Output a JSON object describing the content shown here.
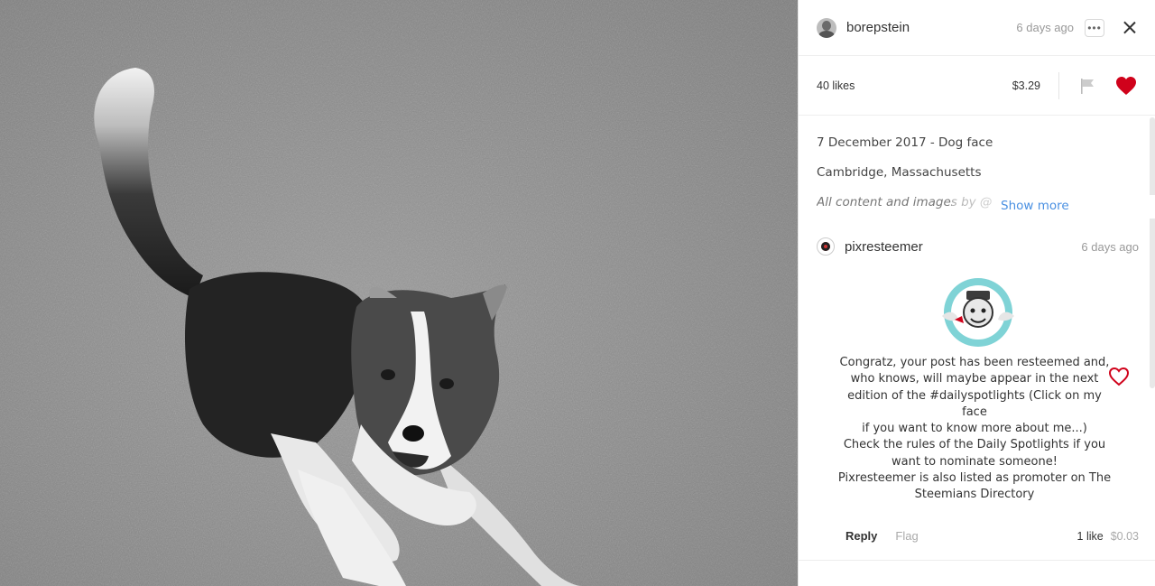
{
  "post": {
    "author": "borepstein",
    "time": "6 days ago",
    "more_label": "•••",
    "likes": "40 likes",
    "payout": "$3.29",
    "title_line": "7 December 2017 - Dog face",
    "location": "Cambridge, Massachusetts",
    "truncated_text": "All content and images by @",
    "show_more": "Show more"
  },
  "comment": {
    "author": "pixresteemer",
    "time": "6 days ago",
    "lines": [
      "Congratz, your post has been resteemed and,",
      "who knows, will maybe appear in the next",
      "edition of the #dailyspotlights (Click on my face",
      "if you want to know more about me...)",
      "Check the rules of the Daily Spotlights if you",
      "want to nominate someone!",
      "Pixresteemer is also listed as promoter on The",
      "Steemians Directory"
    ],
    "reply": "Reply",
    "flag": "Flag",
    "likes": "1 like",
    "payout": "$0.03"
  },
  "colors": {
    "heart_red": "#d0021b",
    "link_blue": "#4a90e2"
  },
  "icons": [
    "avatar",
    "more-icon",
    "close-icon",
    "flag-icon",
    "heart-filled-icon",
    "heart-outline-icon",
    "badge-image"
  ]
}
